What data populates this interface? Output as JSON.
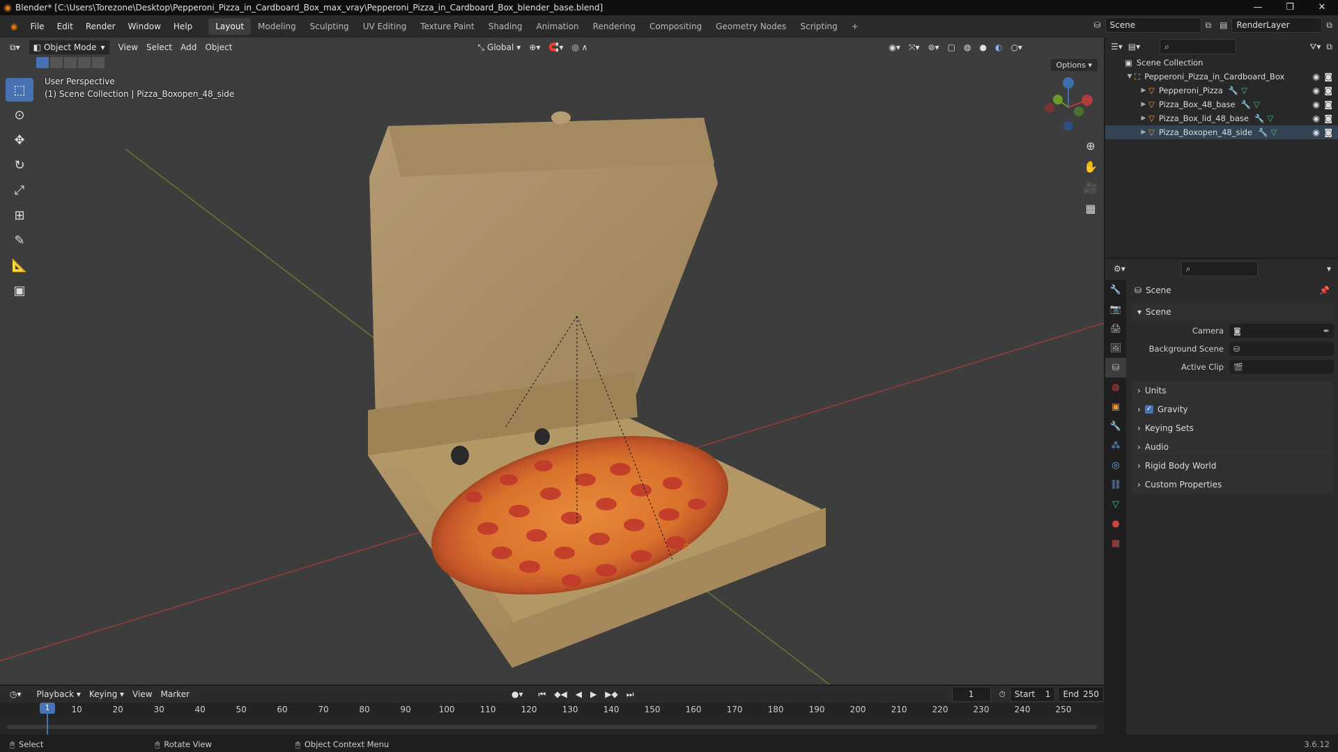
{
  "window": {
    "title": "Blender* [C:\\Users\\Torezone\\Desktop\\Pepperoni_Pizza_in_Cardboard_Box_max_vray\\Pepperoni_Pizza_in_Cardboard_Box_blender_base.blend]"
  },
  "menu": [
    "File",
    "Edit",
    "Render",
    "Window",
    "Help"
  ],
  "workspaces": [
    "Layout",
    "Modeling",
    "Sculpting",
    "UV Editing",
    "Texture Paint",
    "Shading",
    "Animation",
    "Rendering",
    "Compositing",
    "Geometry Nodes",
    "Scripting",
    "+"
  ],
  "active_workspace": "Layout",
  "topright": {
    "scene": "Scene",
    "view_layer": "RenderLayer"
  },
  "viewport_header": {
    "mode": "Object Mode",
    "menus": [
      "View",
      "Select",
      "Add",
      "Object"
    ],
    "orientation": "Global",
    "options": "Options"
  },
  "viewport_overlay": {
    "line1": "User Perspective",
    "line2": "(1) Scene Collection | Pizza_Boxopen_48_side"
  },
  "outliner": {
    "root": "Scene Collection",
    "collection": "Pepperoni_Pizza_in_Cardboard_Box",
    "objects": [
      "Pepperoni_Pizza",
      "Pizza_Box_48_base",
      "Pizza_Box_lid_48_base",
      "Pizza_Boxopen_48_side"
    ]
  },
  "properties": {
    "context": "Scene",
    "panel": "Scene",
    "fields": [
      {
        "label": "Camera",
        "value": ""
      },
      {
        "label": "Background Scene",
        "value": ""
      },
      {
        "label": "Active Clip",
        "value": ""
      }
    ],
    "sections": [
      "Units",
      "Gravity",
      "Keying Sets",
      "Audio",
      "Rigid Body World",
      "Custom Properties"
    ],
    "gravity_checked": true
  },
  "timeline": {
    "menus": [
      "Playback",
      "Keying",
      "View",
      "Marker"
    ],
    "current_frame": "1",
    "start_label": "Start",
    "start": "1",
    "end_label": "End",
    "end": "250",
    "ticks": [
      "1",
      "10",
      "20",
      "30",
      "40",
      "50",
      "60",
      "70",
      "80",
      "90",
      "100",
      "110",
      "120",
      "130",
      "140",
      "150",
      "160",
      "170",
      "180",
      "190",
      "200",
      "210",
      "220",
      "230",
      "240",
      "250"
    ]
  },
  "status": {
    "select": "Select",
    "rotate": "Rotate View",
    "context": "Object Context Menu",
    "version": "3.6.12"
  },
  "colors": {
    "accent": "#4772b3",
    "x_axis": "#b03c3c",
    "y_axis": "#6a9a2a",
    "cardboard": "#b89a6a"
  }
}
